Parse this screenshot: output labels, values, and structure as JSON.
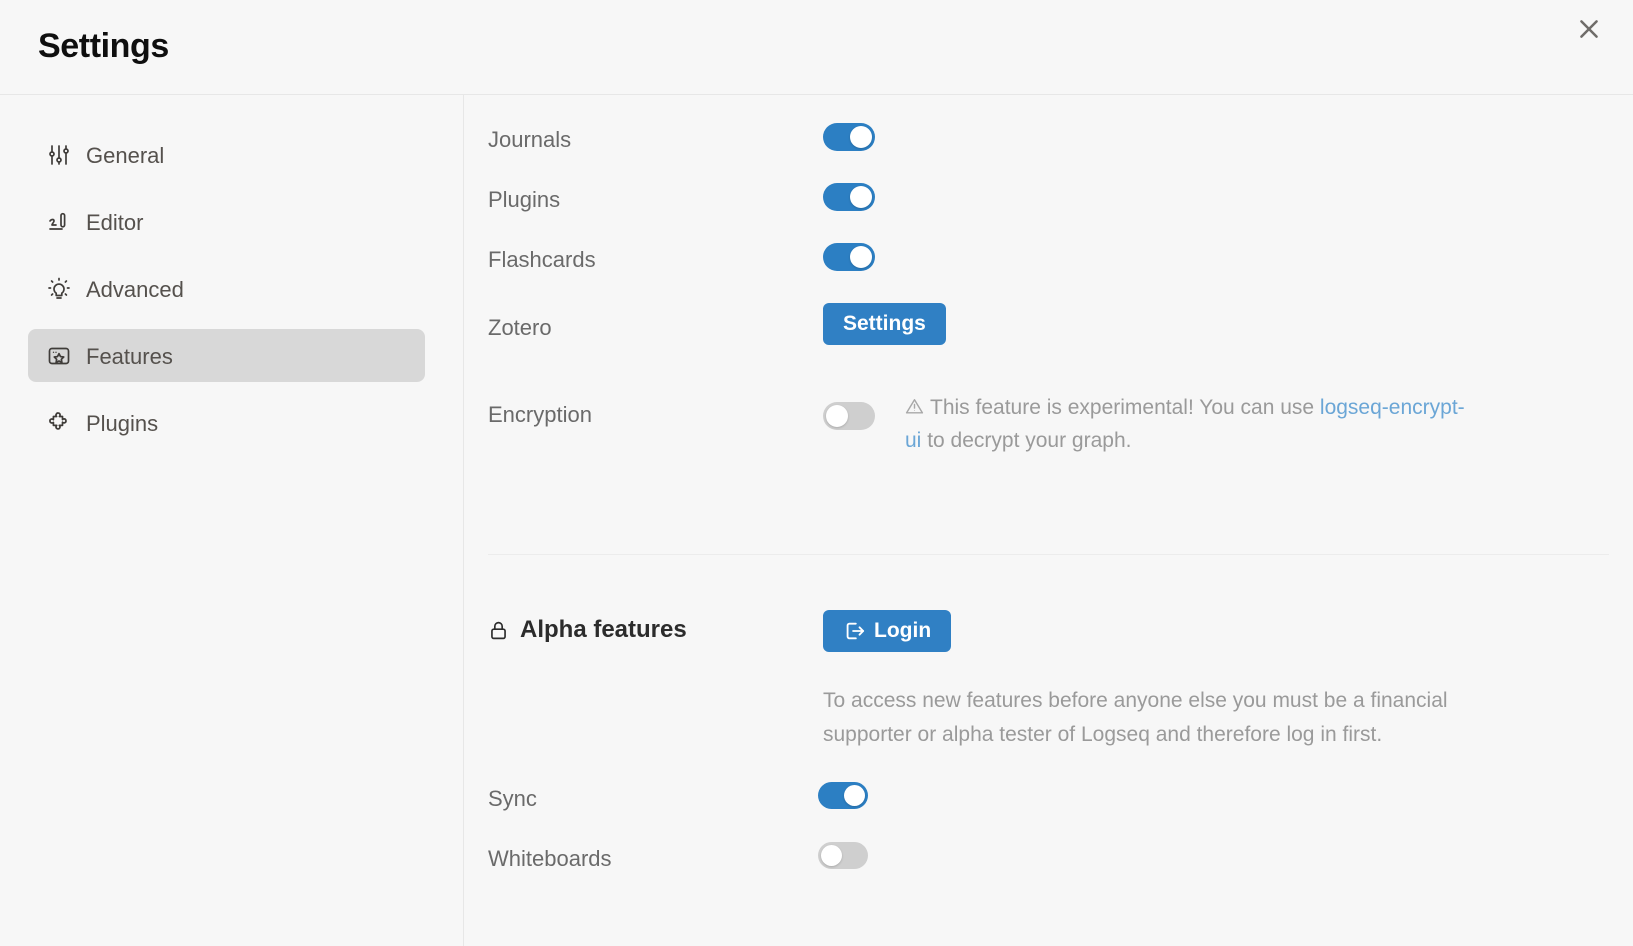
{
  "window": {
    "title": "Settings",
    "close_label": "×"
  },
  "sidebar": {
    "items": [
      {
        "label": "General",
        "icon": "sliders-icon",
        "active": false
      },
      {
        "label": "Editor",
        "icon": "pen-write-icon",
        "active": false
      },
      {
        "label": "Advanced",
        "icon": "bulb-icon",
        "active": false
      },
      {
        "label": "Features",
        "icon": "photo-star-icon",
        "active": true
      },
      {
        "label": "Plugins",
        "icon": "puzzle-icon",
        "active": false
      }
    ]
  },
  "features": {
    "rows": [
      {
        "label": "Journals",
        "toggle": "on"
      },
      {
        "label": "Plugins",
        "toggle": "on"
      },
      {
        "label": "Flashcards",
        "toggle": "on"
      }
    ],
    "zotero": {
      "label": "Zotero",
      "button_label": "Settings"
    },
    "encryption": {
      "label": "Encryption",
      "toggle": "off",
      "note_prefix": "This feature is experimental! You can use ",
      "note_link": "logseq-encrypt-ui",
      "note_suffix": " to decrypt your graph.",
      "warning_icon": "warning-triangle-icon"
    }
  },
  "alpha": {
    "heading": "Alpha features",
    "heading_icon": "lock-icon",
    "login_button_label": "Login",
    "login_button_icon": "login-arrow-icon",
    "description": "To access new features before anyone else you must be a financial supporter or alpha tester of Logseq and therefore log in first.",
    "rows": [
      {
        "label": "Sync",
        "toggle": "on"
      },
      {
        "label": "Whiteboards",
        "toggle": "off"
      }
    ]
  },
  "colors": {
    "accent": "#3080c4",
    "toggle_on": "#2c7fc3",
    "toggle_off": "#cfcfcf",
    "link": "#6ba6d6",
    "background": "#f7f7f7",
    "active_nav": "#d8d8d8",
    "muted_text": "#9a9a9a"
  }
}
